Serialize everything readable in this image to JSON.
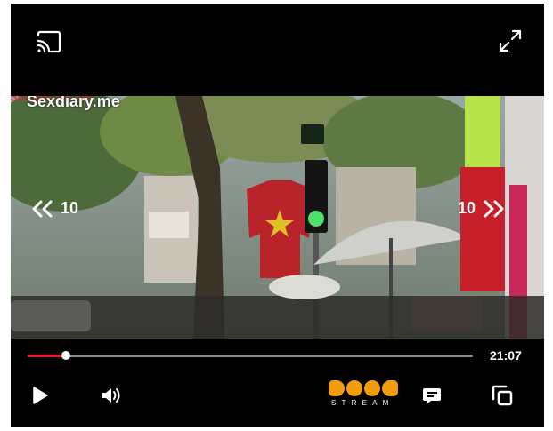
{
  "watermark": {
    "red_text": "sexdiaryX.net",
    "white_text": "Sexdiary.me"
  },
  "controls": {
    "seek_back_label": "10",
    "seek_forward_label": "10",
    "duration": "21:07",
    "progress_fraction": 0.085
  },
  "brand": {
    "word": "STREAM"
  },
  "colors": {
    "accent": "#e8192c",
    "brand": "#f29d0c",
    "background": "#000000"
  },
  "icons": [
    "cast-icon",
    "fullscreen-icon",
    "rewind-icon",
    "forward-icon",
    "play-icon",
    "volume-icon",
    "chat-icon",
    "picture-in-picture-icon"
  ]
}
